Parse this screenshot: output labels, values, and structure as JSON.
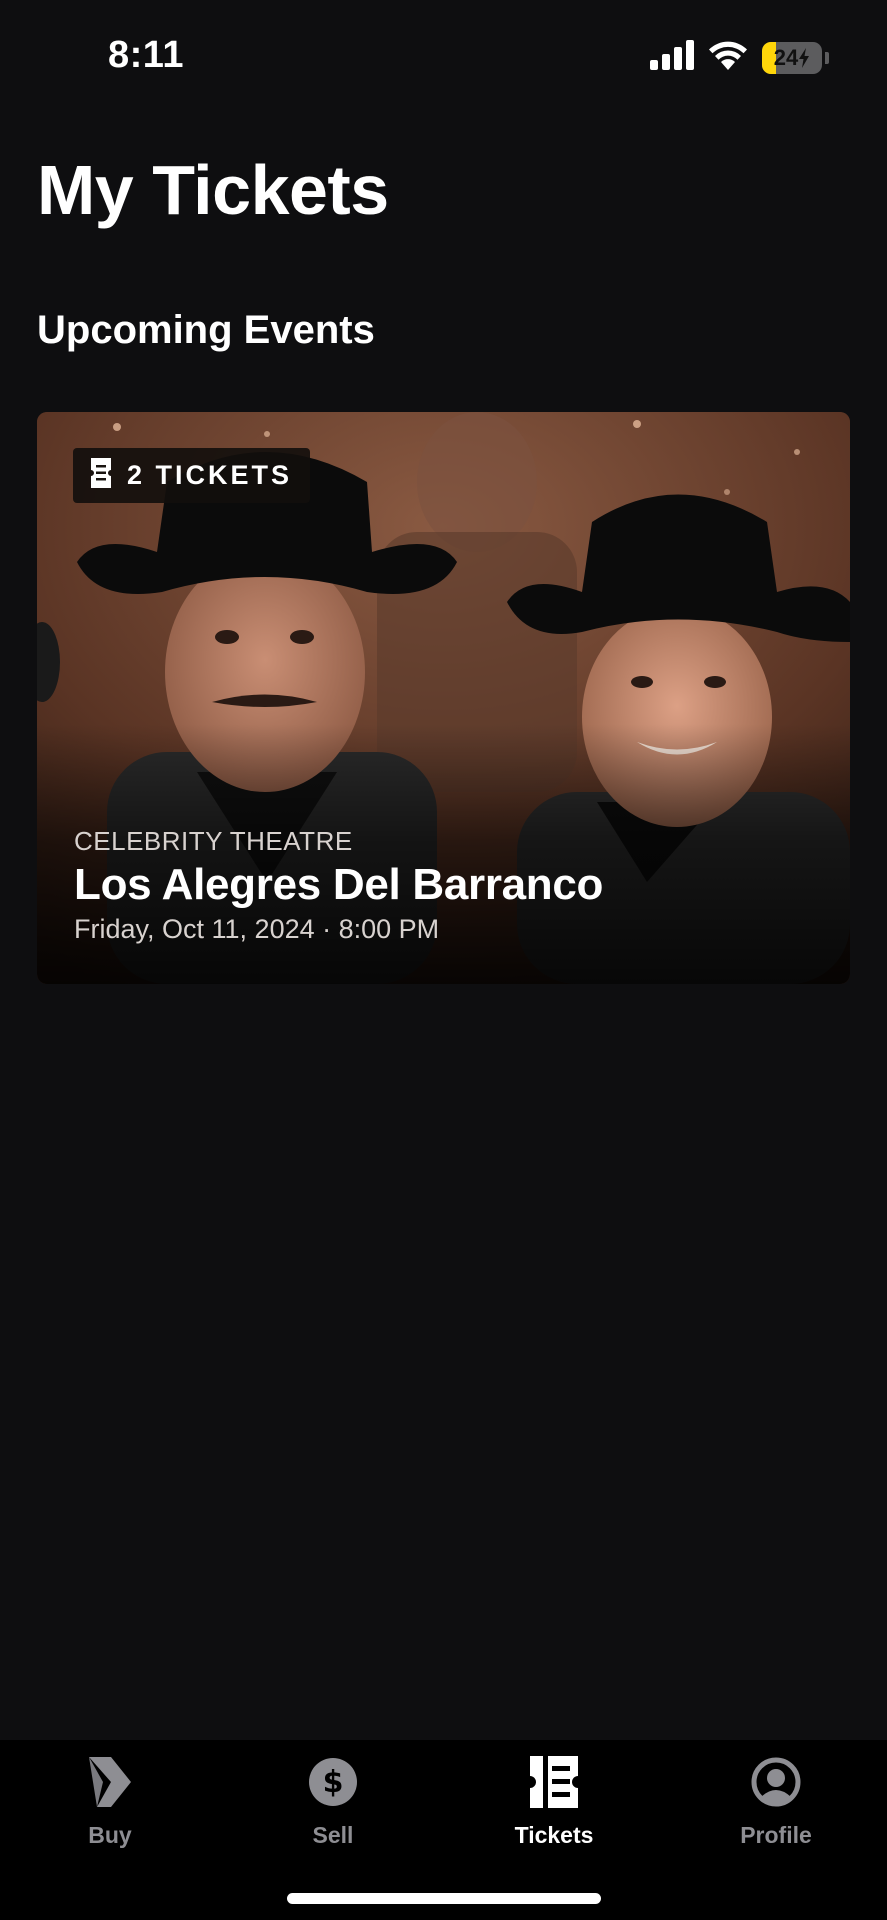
{
  "status_bar": {
    "time": "8:11",
    "battery_level": "24",
    "battery_percent": 24,
    "icons": [
      "cellular-signal-icon",
      "wifi-icon",
      "battery-charging-icon"
    ]
  },
  "header": {
    "title": "My Tickets"
  },
  "section": {
    "title": "Upcoming Events"
  },
  "events": [
    {
      "ticket_count_label": "2 TICKETS",
      "venue": "CELEBRITY THEATRE",
      "name": "Los Alegres Del Barranco",
      "datetime": "Friday, Oct 11, 2024 · 8:00 PM"
    }
  ],
  "tab_bar": {
    "tabs": [
      {
        "label": "Buy",
        "icon": "buy-chevron-icon",
        "active": false
      },
      {
        "label": "Sell",
        "icon": "dollar-icon",
        "active": false
      },
      {
        "label": "Tickets",
        "icon": "ticket-icon",
        "active": true
      },
      {
        "label": "Profile",
        "icon": "profile-icon",
        "active": false
      }
    ]
  },
  "colors": {
    "background": "#0e0e10",
    "tab_bar": "#000000",
    "inactive_tab": "#8e8e93",
    "active_tab": "#ffffff",
    "battery_fill": "#ffd60a"
  }
}
